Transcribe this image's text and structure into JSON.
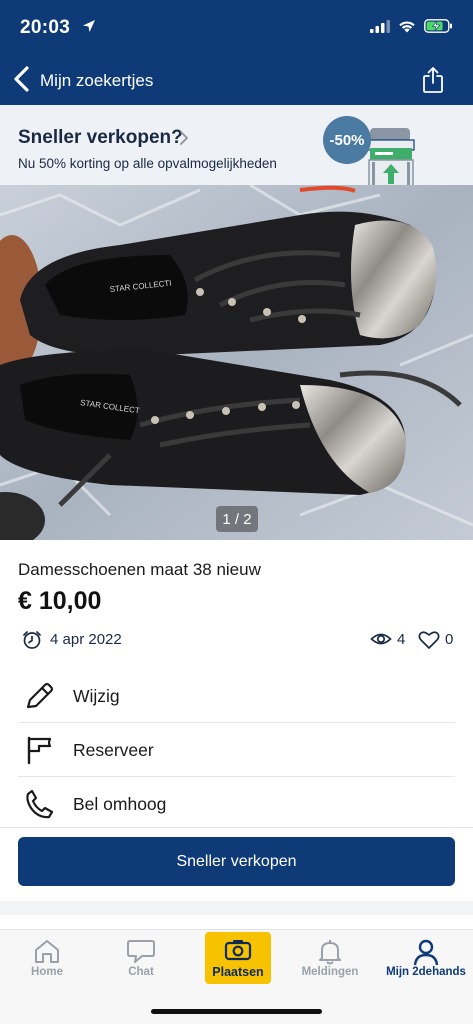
{
  "status_bar": {
    "time": "20:03",
    "location_icon": "location-arrow-icon",
    "signal_icon": "cellular-signal-icon",
    "wifi_icon": "wifi-icon",
    "battery_icon": "battery-charging-icon"
  },
  "nav": {
    "back_label": "Mijn zoekertjes",
    "share_icon": "share-icon"
  },
  "promo": {
    "title": "Sneller verkopen?",
    "subtitle": "Nu 50% korting op alle opvalmogelijkheden",
    "badge": "-50%"
  },
  "photo": {
    "counter": "1 / 2",
    "brand_text": "STAR COLLECTI",
    "brand_text_2": "STAR COLLECT"
  },
  "listing": {
    "title": "Damesschoenen maat 38 nieuw",
    "price": "€ 10,00",
    "date": "4 apr 2022",
    "views": "4",
    "favorites": "0"
  },
  "actions": [
    {
      "label": "Wijzig",
      "icon": "pencil-icon"
    },
    {
      "label": "Reserveer",
      "icon": "flag-icon"
    },
    {
      "label": "Bel omhoog",
      "icon": "phone-icon"
    }
  ],
  "primary_button": {
    "label": "Sneller verkopen"
  },
  "tabs": [
    {
      "label": "Home",
      "icon": "home-icon"
    },
    {
      "label": "Chat",
      "icon": "chat-icon"
    },
    {
      "label": "Plaatsen",
      "icon": "camera-icon"
    },
    {
      "label": "Meldingen",
      "icon": "bell-icon"
    },
    {
      "label": "Mijn 2dehands",
      "icon": "profile-icon"
    }
  ],
  "colors": {
    "brand_navy": "#0e3b78",
    "accent_yellow": "#f7c300",
    "promo_background": "#eef1f6",
    "inactive_tab": "#9aa1ab"
  }
}
